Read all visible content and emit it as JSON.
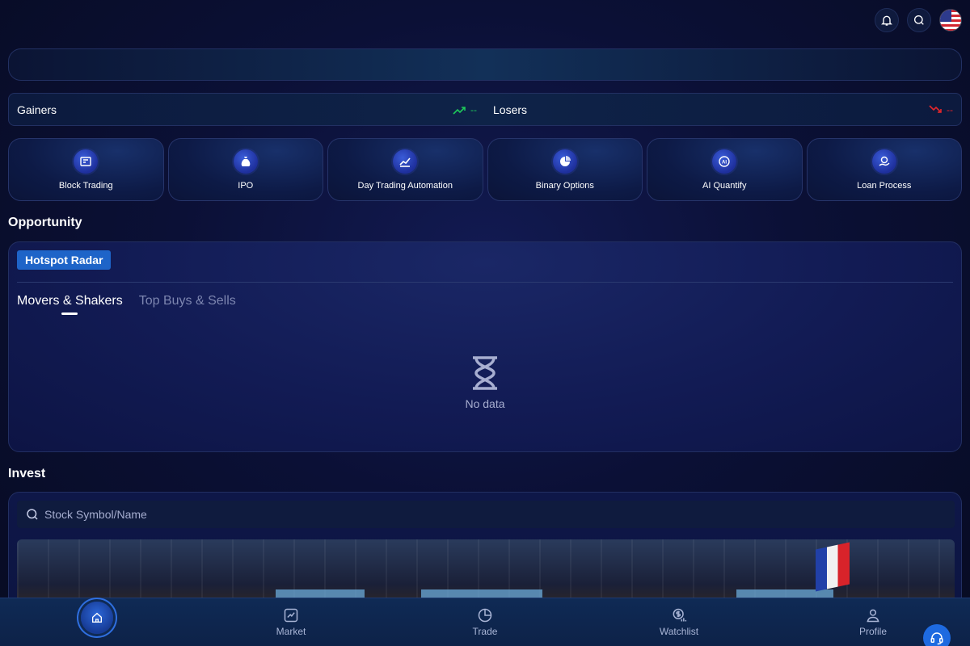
{
  "movers": {
    "gainers_label": "Gainers",
    "gainers_value": "--",
    "losers_label": "Losers",
    "losers_value": "--"
  },
  "features": [
    {
      "label": "Block Trading",
      "icon": "block-trading-icon"
    },
    {
      "label": "IPO",
      "icon": "ipo-moneybag-icon"
    },
    {
      "label": "Day Trading Automation",
      "icon": "chart-trend-icon"
    },
    {
      "label": "Binary Options",
      "icon": "pie-chart-icon"
    },
    {
      "label": "AI Quantify",
      "icon": "ai-icon"
    },
    {
      "label": "Loan Process",
      "icon": "loan-hand-icon"
    }
  ],
  "opportunity": {
    "title": "Opportunity",
    "badge": "Hotspot Radar",
    "tabs": [
      {
        "label": "Movers & Shakers",
        "active": true
      },
      {
        "label": "Top Buys & Sells",
        "active": false
      }
    ],
    "empty_text": "No data"
  },
  "invest": {
    "title": "Invest",
    "search_placeholder": "Stock Symbol/Name"
  },
  "nav": {
    "market": "Market",
    "trade": "Trade",
    "watchlist": "Watchlist",
    "profile": "Profile"
  },
  "colors": {
    "gain": "#1ec95a",
    "loss": "#e5262b",
    "accent": "#1e64c8"
  }
}
